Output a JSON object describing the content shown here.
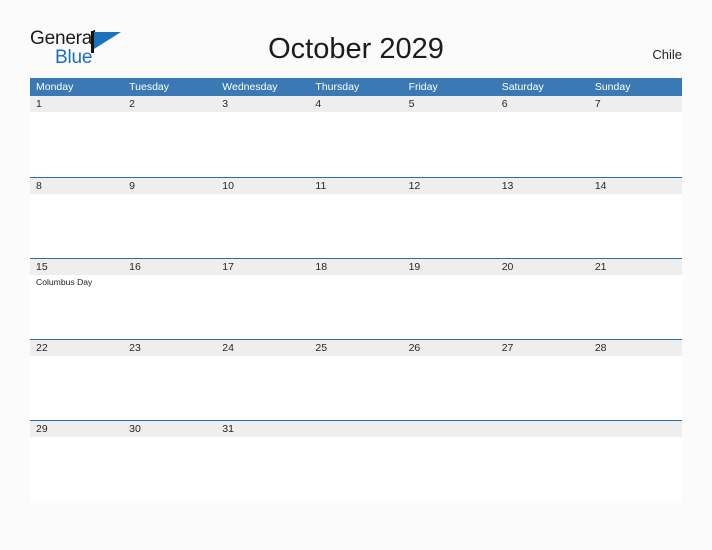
{
  "logo": {
    "word_one": "General",
    "word_two": "Blue",
    "flag_icon": "flag-triangle-icon",
    "brand_blue": "#1b72b8",
    "brand_dark": "#141414"
  },
  "header": {
    "title": "October 2029",
    "country": "Chile"
  },
  "theme": {
    "header_blue": "#3b79b4",
    "row_divider_blue": "#2e6da4",
    "date_band_gray": "#eeeeee",
    "page_background": "#fbfbfc",
    "text_dark": "#262626",
    "day_header_text": "#ffffff"
  },
  "calendar": {
    "day_headers": [
      "Monday",
      "Tuesday",
      "Wednesday",
      "Thursday",
      "Friday",
      "Saturday",
      "Sunday"
    ],
    "weeks": [
      {
        "days": [
          {
            "number": "1",
            "events": []
          },
          {
            "number": "2",
            "events": []
          },
          {
            "number": "3",
            "events": []
          },
          {
            "number": "4",
            "events": []
          },
          {
            "number": "5",
            "events": []
          },
          {
            "number": "6",
            "events": []
          },
          {
            "number": "7",
            "events": []
          }
        ]
      },
      {
        "days": [
          {
            "number": "8",
            "events": []
          },
          {
            "number": "9",
            "events": []
          },
          {
            "number": "10",
            "events": []
          },
          {
            "number": "11",
            "events": []
          },
          {
            "number": "12",
            "events": []
          },
          {
            "number": "13",
            "events": []
          },
          {
            "number": "14",
            "events": []
          }
        ]
      },
      {
        "days": [
          {
            "number": "15",
            "events": [
              "Columbus Day"
            ]
          },
          {
            "number": "16",
            "events": []
          },
          {
            "number": "17",
            "events": []
          },
          {
            "number": "18",
            "events": []
          },
          {
            "number": "19",
            "events": []
          },
          {
            "number": "20",
            "events": []
          },
          {
            "number": "21",
            "events": []
          }
        ]
      },
      {
        "days": [
          {
            "number": "22",
            "events": []
          },
          {
            "number": "23",
            "events": []
          },
          {
            "number": "24",
            "events": []
          },
          {
            "number": "25",
            "events": []
          },
          {
            "number": "26",
            "events": []
          },
          {
            "number": "27",
            "events": []
          },
          {
            "number": "28",
            "events": []
          }
        ]
      },
      {
        "days": [
          {
            "number": "29",
            "events": []
          },
          {
            "number": "30",
            "events": []
          },
          {
            "number": "31",
            "events": []
          },
          {
            "number": "",
            "events": []
          },
          {
            "number": "",
            "events": []
          },
          {
            "number": "",
            "events": []
          },
          {
            "number": "",
            "events": []
          }
        ]
      }
    ]
  }
}
